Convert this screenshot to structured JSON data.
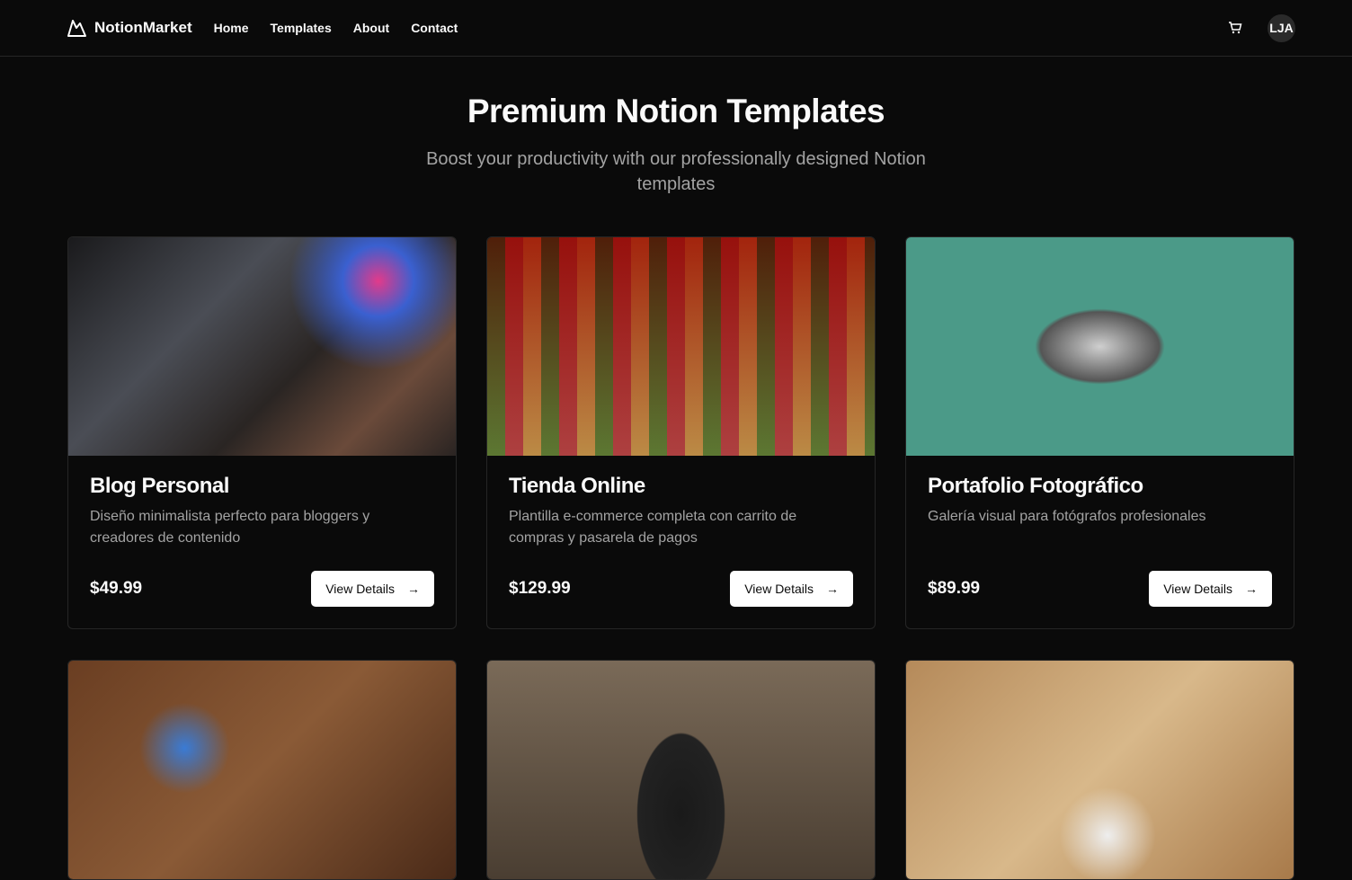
{
  "nav": {
    "brand": "NotionMarket",
    "links": [
      "Home",
      "Templates",
      "About",
      "Contact"
    ],
    "avatar": "LJA"
  },
  "hero": {
    "title": "Premium Notion Templates",
    "subtitle": "Boost your productivity with our professionally designed Notion templates"
  },
  "cards": [
    {
      "title": "Blog Personal",
      "description": "Diseño minimalista perfecto para bloggers y creadores de contenido",
      "price": "$49.99",
      "button": "View Details"
    },
    {
      "title": "Tienda Online",
      "description": "Plantilla e-commerce completa con carrito de compras y pasarela de pagos",
      "price": "$129.99",
      "button": "View Details"
    },
    {
      "title": "Portafolio Fotográfico",
      "description": "Galería visual para fotógrafos profesionales",
      "price": "$89.99",
      "button": "View Details"
    }
  ]
}
